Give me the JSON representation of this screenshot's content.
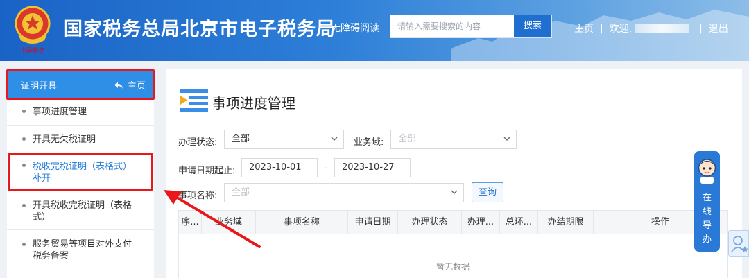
{
  "header": {
    "title": "国家税务总局北京市电子税务局",
    "accessibility": "无障碍阅读",
    "search_placeholder": "请输入需要搜索的内容",
    "search_button": "搜索",
    "home_link": "主页",
    "sep1": "|",
    "welcome": "欢迎,",
    "sep2": "|",
    "logout": "退出"
  },
  "sidebar": {
    "head_title": "证明开具",
    "home_label": "主页",
    "items": [
      {
        "label": "事项进度管理"
      },
      {
        "label": "开具无欠税证明"
      },
      {
        "label_line1": "税收完税证明（表格式）",
        "label_line2": "补开"
      },
      {
        "label_line1": "开具税收完税证明（表格",
        "label_line2": "式）"
      },
      {
        "label_line1": "服务贸易等项目对外支付",
        "label_line2": "税务备案"
      }
    ]
  },
  "main": {
    "title": "事项进度管理",
    "filters": {
      "status_label": "办理状态:",
      "status_value": "全部",
      "domain_label": "业务域:",
      "domain_value": "全部",
      "date_label": "申请日期起止:",
      "date_from": "2023-10-01",
      "date_sep": "-",
      "date_to": "2023-10-27",
      "item_label": "事项名称:",
      "item_value": "全部",
      "query_button": "查询"
    },
    "table": {
      "columns": [
        "序...",
        "业务域",
        "事项名称",
        "申请日期",
        "办理状态",
        "办理...",
        "总环...",
        "办结期限",
        "操作"
      ],
      "empty_text": "暂无数据"
    }
  },
  "guide": {
    "lines": [
      "在",
      "线",
      "导",
      "办"
    ]
  },
  "colors": {
    "header_blue": "#1a63c6",
    "accent_blue": "#2f8ee5",
    "highlight_red": "#e8171c"
  }
}
